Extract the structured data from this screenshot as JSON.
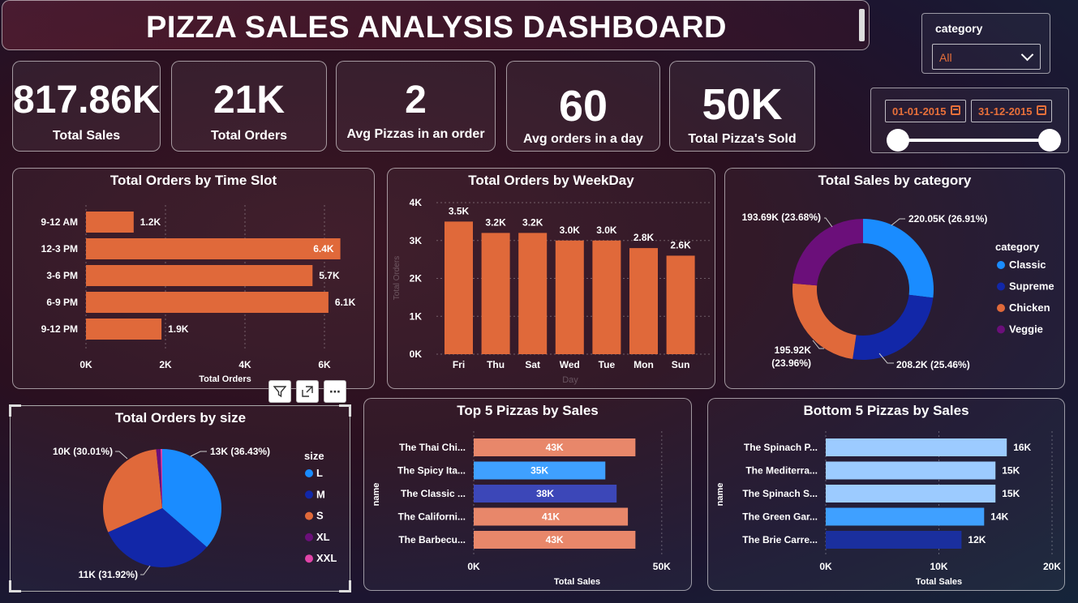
{
  "header": {
    "title": "PIZZA SALES ANALYSIS DASHBOARD"
  },
  "kpis": [
    {
      "value": "817.86K",
      "label": "Total Sales"
    },
    {
      "value": "21K",
      "label": "Total Orders"
    },
    {
      "value": "2",
      "label": "Avg Pizzas in an order"
    },
    {
      "value": "60",
      "label": "Avg orders in a day"
    },
    {
      "value": "50K",
      "label": "Total Pizza's Sold"
    }
  ],
  "slicers": {
    "category": {
      "label": "category",
      "selected": "All"
    },
    "date": {
      "start": "01-01-2015",
      "end": "31-12-2015"
    }
  },
  "visual_header": {
    "icons": [
      "filter-icon",
      "focus-mode-icon",
      "more-options-icon"
    ],
    "more_glyph": "⋯"
  },
  "colors": {
    "orange": "#E0693A",
    "light_orange": "#E8876A",
    "classic": "#1A8CFF",
    "supreme": "#1227A8",
    "chicken": "#E0693A",
    "veggie": "#6B0F7A",
    "xxl": "#E044A8",
    "light_blue": "#9CCBFF",
    "mid_blue": "#3FA0FF",
    "dark_blue": "#1A2F9E",
    "indigo": "#3C47B8"
  },
  "chart_data": [
    {
      "id": "time_slot",
      "type": "bar",
      "orientation": "horizontal",
      "title": "Total Orders by Time Slot",
      "xlabel": "Total Orders",
      "ylabel": "",
      "categories": [
        "9-12 AM",
        "12-3 PM",
        "3-6 PM",
        "6-9 PM",
        "9-12 PM"
      ],
      "values": [
        1200,
        6400,
        5700,
        6100,
        1900
      ],
      "data_labels": [
        "1.2K",
        "6.4K",
        "5.7K",
        "6.1K",
        "1.9K"
      ],
      "xlim": [
        0,
        7000
      ],
      "ticks": [
        0,
        2000,
        4000,
        6000
      ],
      "tick_labels": [
        "0K",
        "2K",
        "4K",
        "6K"
      ],
      "grid": true
    },
    {
      "id": "weekday",
      "type": "bar",
      "orientation": "vertical",
      "title": "Total Orders by WeekDay",
      "xlabel": "Day",
      "ylabel": "Total Orders",
      "categories": [
        "Fri",
        "Thu",
        "Sat",
        "Wed",
        "Tue",
        "Mon",
        "Sun"
      ],
      "values": [
        3500,
        3200,
        3200,
        3000,
        3000,
        2800,
        2600
      ],
      "data_labels": [
        "3.5K",
        "3.2K",
        "3.2K",
        "3.0K",
        "3.0K",
        "2.8K",
        "2.6K"
      ],
      "ylim": [
        0,
        4000
      ],
      "ticks": [
        0,
        1000,
        2000,
        3000,
        4000
      ],
      "tick_labels": [
        "0K",
        "1K",
        "2K",
        "3K",
        "4K"
      ],
      "grid": true
    },
    {
      "id": "category_sales",
      "type": "pie",
      "donut": true,
      "title": "Total Sales by category",
      "legend_title": "category",
      "legend_position": "right",
      "slices": [
        {
          "name": "Classic",
          "value": 220.05,
          "label": "220.05K (26.91%)"
        },
        {
          "name": "Supreme",
          "value": 208.2,
          "label": "208.2K (25.46%)"
        },
        {
          "name": "Chicken",
          "value": 195.92,
          "label_line1": "195.92K",
          "label_line2": "(23.96%)"
        },
        {
          "name": "Veggie",
          "value": 193.69,
          "label": "193.69K (23.68%)"
        }
      ]
    },
    {
      "id": "size_orders",
      "type": "pie",
      "donut": false,
      "title": "Total Orders by size",
      "legend_title": "size",
      "legend_position": "right",
      "slices": [
        {
          "name": "L",
          "value": 36.43,
          "label": "13K (36.43%)"
        },
        {
          "name": "M",
          "value": 31.92,
          "label": "11K (31.92%)"
        },
        {
          "name": "S",
          "value": 30.01,
          "label": "10K (30.01%)"
        },
        {
          "name": "XL",
          "value": 1.2,
          "label": ""
        },
        {
          "name": "XXL",
          "value": 0.44,
          "label": ""
        }
      ]
    },
    {
      "id": "top5",
      "type": "bar",
      "orientation": "horizontal",
      "title": "Top 5 Pizzas by Sales",
      "xlabel": "Total Sales",
      "ylabel": "name",
      "categories": [
        "The Thai Chi...",
        "The Spicy Ita...",
        "The Classic ...",
        "The Californi...",
        "The Barbecu..."
      ],
      "values": [
        43000,
        35000,
        38000,
        41000,
        43000
      ],
      "data_labels": [
        "43K",
        "35K",
        "38K",
        "41K",
        "43K"
      ],
      "xlim": [
        0,
        55000
      ],
      "ticks": [
        0,
        50000
      ],
      "tick_labels": [
        "0K",
        "50K"
      ],
      "grid": true
    },
    {
      "id": "bottom5",
      "type": "bar",
      "orientation": "horizontal",
      "title": "Bottom 5 Pizzas by Sales",
      "xlabel": "Total Sales",
      "ylabel": "name",
      "categories": [
        "The Spinach P...",
        "The Mediterra...",
        "The Spinach S...",
        "The Green Gar...",
        "The Brie Carre..."
      ],
      "values": [
        16000,
        15000,
        15000,
        14000,
        12000
      ],
      "data_labels": [
        "16K",
        "15K",
        "15K",
        "14K",
        "12K"
      ],
      "xlim": [
        0,
        20000
      ],
      "ticks": [
        0,
        10000,
        20000
      ],
      "tick_labels": [
        "0K",
        "10K",
        "20K"
      ],
      "grid": true
    }
  ]
}
